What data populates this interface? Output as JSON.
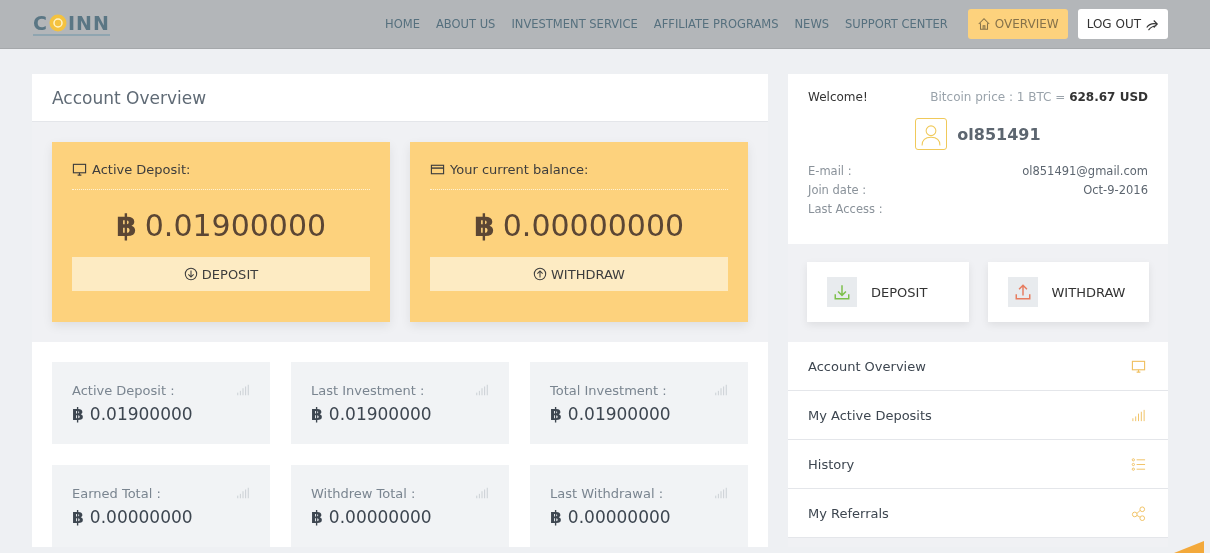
{
  "logo": {
    "before": "C",
    "after": "INN"
  },
  "nav": [
    {
      "label": "HOME"
    },
    {
      "label": "ABOUT US"
    },
    {
      "label": "INVESTMENT SERVICE"
    },
    {
      "label": "AFFILIATE PROGRAMS"
    },
    {
      "label": "NEWS"
    },
    {
      "label": "SUPPORT CENTER"
    }
  ],
  "header_buttons": [
    {
      "kind": "overview",
      "label": "OVERVIEW"
    },
    {
      "kind": "logout",
      "label": "LOG OUT"
    }
  ],
  "main": {
    "title": "Account Overview",
    "highlights": [
      {
        "kind": "deposit",
        "label": "Active Deposit:",
        "symbol": "฿",
        "amount": "0.01900000",
        "button": "DEPOSIT"
      },
      {
        "kind": "balance",
        "label": "Your current balance:",
        "symbol": "฿",
        "amount": "0.00000000",
        "button": "WITHDRAW"
      }
    ],
    "stats": [
      {
        "label": "Active Deposit :",
        "symbol": "฿",
        "amount": "0.01900000"
      },
      {
        "label": "Last Investment :",
        "symbol": "฿",
        "amount": "0.01900000"
      },
      {
        "label": "Total Investment :",
        "symbol": "฿",
        "amount": "0.01900000"
      },
      {
        "label": "Earned Total :",
        "symbol": "฿",
        "amount": "0.00000000"
      },
      {
        "label": "Withdrew Total :",
        "symbol": "฿",
        "amount": "0.00000000"
      },
      {
        "label": "Last Withdrawal :",
        "symbol": "฿",
        "amount": "0.00000000"
      }
    ]
  },
  "profile": {
    "welcome": "Welcome!",
    "price_label": "Bitcoin price : 1 BTC = ",
    "price_value": "628.67 USD",
    "username": "ol851491",
    "details": [
      {
        "label": "E-mail :",
        "value": "ol851491@gmail.com"
      },
      {
        "label": "Join date :",
        "value": "Oct-9-2016"
      },
      {
        "label": "Last Access :"
      }
    ],
    "actions": [
      {
        "kind": "deposit",
        "label": "DEPOSIT"
      },
      {
        "kind": "withdraw",
        "label": "WITHDRAW"
      }
    ],
    "menu": [
      {
        "kind": "monitor",
        "label": "Account Overview"
      },
      {
        "kind": "bars",
        "label": "My Active Deposits"
      },
      {
        "kind": "list",
        "label": "History"
      },
      {
        "kind": "share",
        "label": "My Referrals"
      }
    ]
  }
}
